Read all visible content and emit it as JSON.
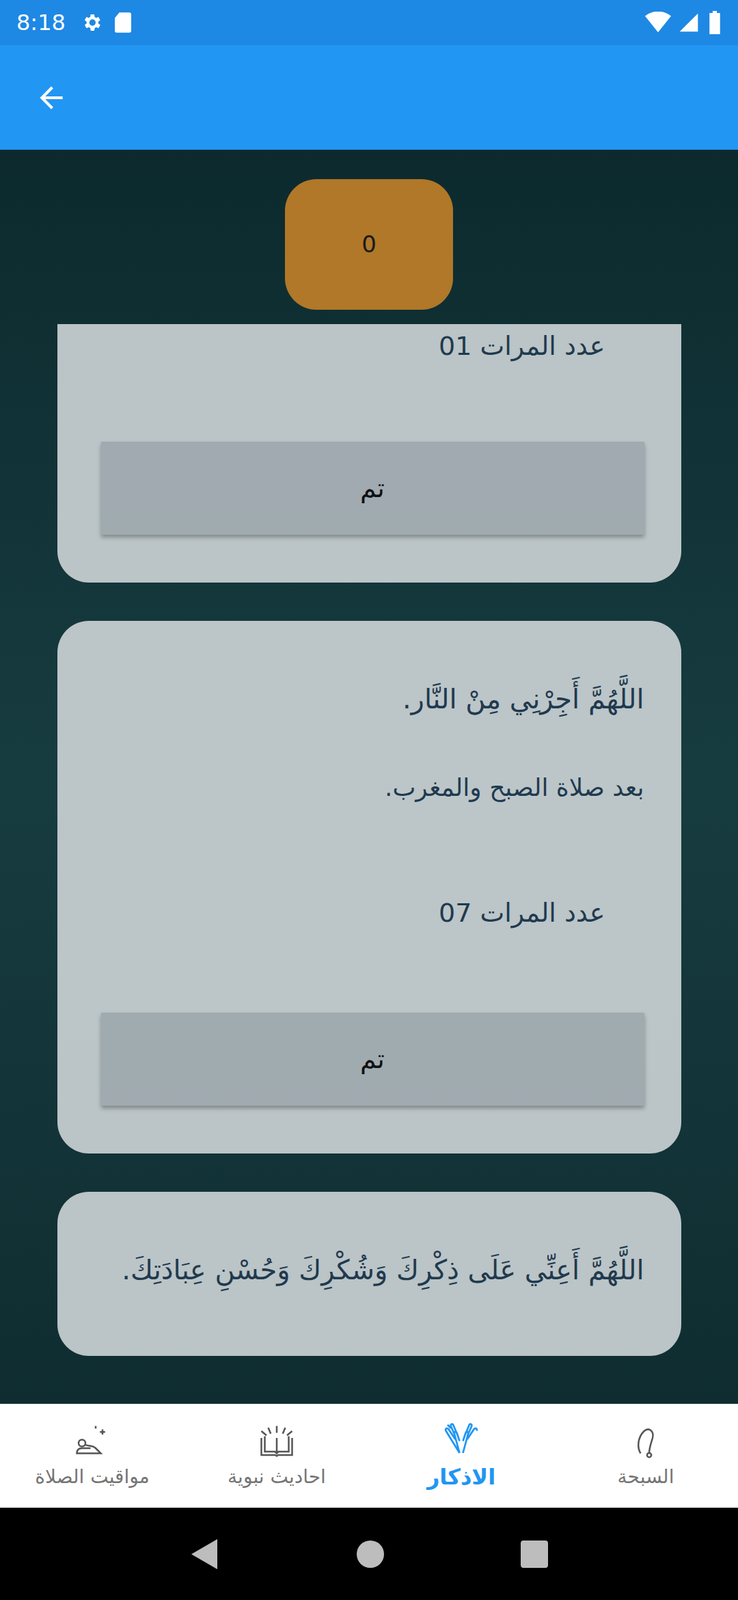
{
  "status_bar": {
    "time": "8:18"
  },
  "counter": {
    "value": "0"
  },
  "cards": [
    {
      "text": "",
      "note": "",
      "count": "عدد المرات 01",
      "button": "تم"
    },
    {
      "text": "اللَّهُمَّ أَجِرْنِي مِنْ النَّار.",
      "note": "بعد صلاة الصبح والمغرب.",
      "count": "عدد المرات 07",
      "button": "تم"
    },
    {
      "text": "اللَّهُمَّ أَعِنِّي عَلَى ذِكْرِكَ وَشُكْرِكَ وَحُسْنِ عِبَادَتِكَ.",
      "note": "",
      "count": "",
      "button": ""
    }
  ],
  "bottom_nav": [
    {
      "label": "السبحة",
      "selected": false,
      "kind": "beads"
    },
    {
      "label": "الاذكار",
      "selected": true,
      "kind": "hands"
    },
    {
      "label": "احاديث نبوية",
      "selected": false,
      "kind": "book"
    },
    {
      "label": "مواقيت الصلاة",
      "selected": false,
      "kind": "prayer"
    }
  ]
}
